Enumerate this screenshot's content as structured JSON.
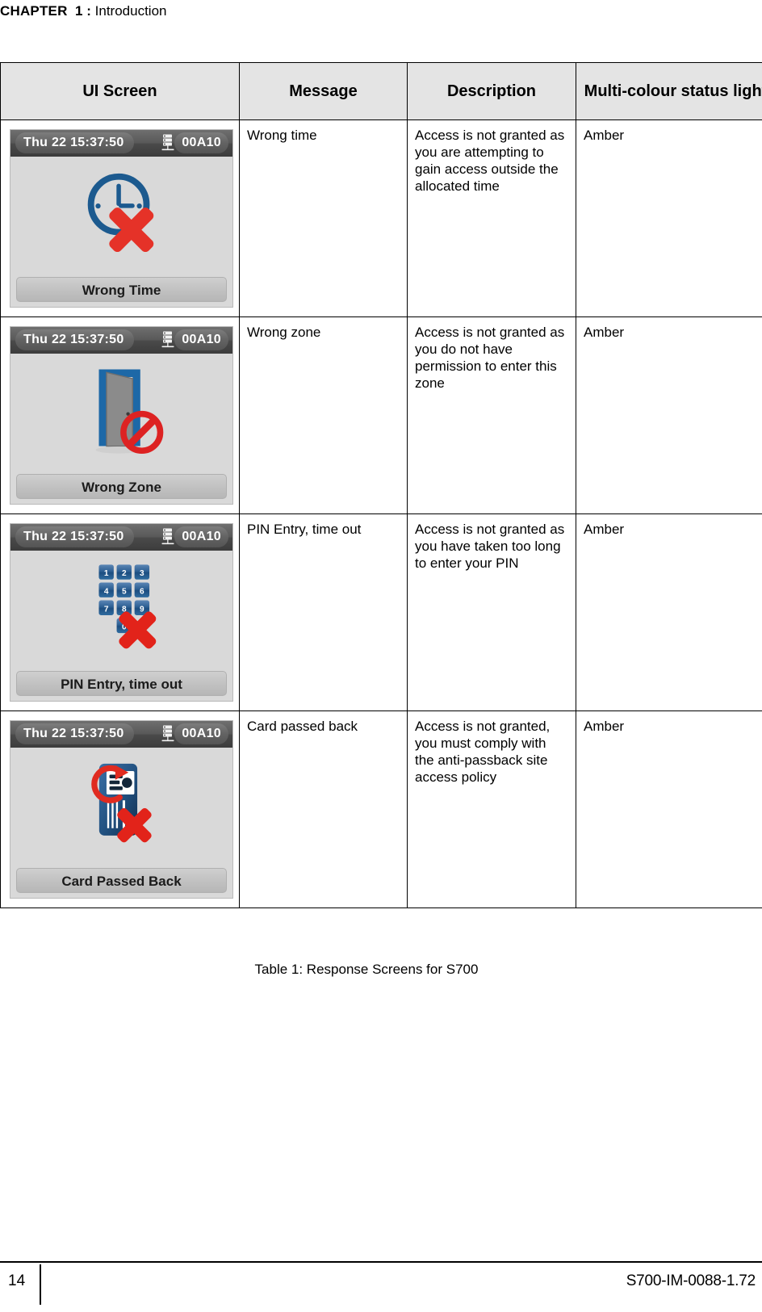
{
  "header": {
    "chapter_word": "CHAPTER",
    "chapter_number": "1",
    "colon": ":",
    "chapter_title": "Introduction"
  },
  "table": {
    "columns": [
      "UI Screen",
      "Message",
      "Description",
      "Multi-colour status light"
    ],
    "caption": "Table 1: Response Screens for S700",
    "rows": [
      {
        "screen": {
          "status_time": "Thu 22 15:37:50",
          "status_id": "00A10",
          "network_icon": "network-server-icon",
          "art": "clock-with-red-cross-icon",
          "caption": "Wrong Time"
        },
        "message": "Wrong time",
        "description": "Access is not granted as you are attempting to gain access outside the allocated time",
        "status_light": "Amber"
      },
      {
        "screen": {
          "status_time": "Thu 22 15:37:50",
          "status_id": "00A10",
          "network_icon": "network-server-icon",
          "art": "open-door-with-no-entry-icon",
          "caption": "Wrong Zone"
        },
        "message": "Wrong zone",
        "description": "Access is not granted as you do not have permission to enter this zone",
        "status_light": "Amber"
      },
      {
        "screen": {
          "status_time": "Thu 22 15:37:50",
          "status_id": "00A10",
          "network_icon": "network-server-icon",
          "art": "keypad-with-red-cross-icon",
          "keypad_keys": [
            "1",
            "2",
            "3",
            "4",
            "5",
            "6",
            "7",
            "8",
            "9",
            "0"
          ],
          "caption": "PIN Entry, time out"
        },
        "message": "PIN Entry, time out",
        "description": "Access is not granted as you have taken too long to enter your PIN",
        "status_light": "Amber"
      },
      {
        "screen": {
          "status_time": "Thu 22 15:37:50",
          "status_id": "00A10",
          "network_icon": "network-server-icon",
          "art": "id-card-passback-with-red-cross-icon",
          "caption": "Card Passed Back"
        },
        "message": "Card passed back",
        "description": "Access is not granted, you must comply with the anti-passback site access policy",
        "status_light": "Amber"
      }
    ]
  },
  "footer": {
    "page_number": "14",
    "document_code": "S700-IM-0088-1.72"
  },
  "colors": {
    "header_fill": "#e4e4e4",
    "device_background": "#d9d9d9",
    "accent_blue": "#1c5a8f",
    "accent_red": "#e02a1f",
    "text": "#000000"
  }
}
